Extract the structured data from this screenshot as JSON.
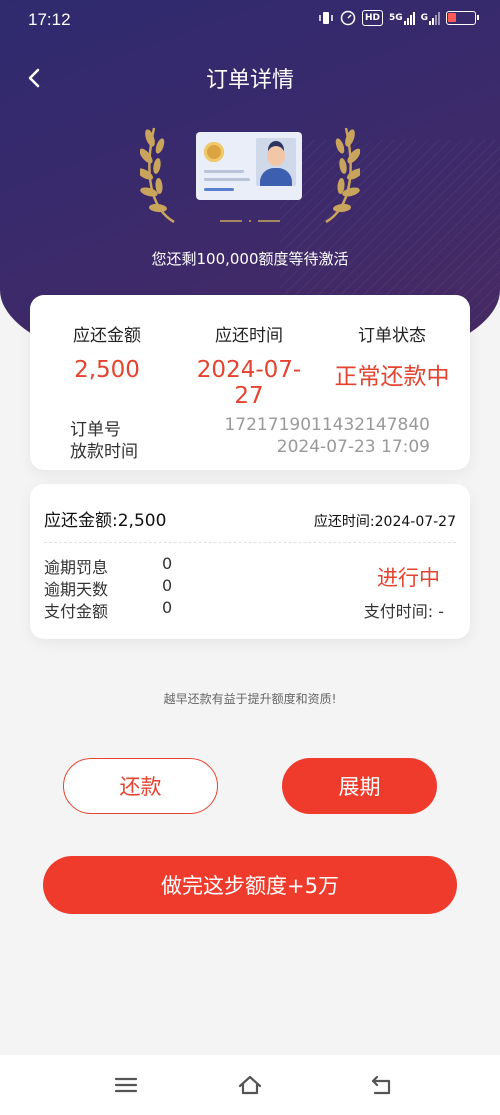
{
  "status_bar": {
    "time": "17:12",
    "hd": "HD",
    "network": "5G",
    "network2": "G"
  },
  "header": {
    "title": "订单详情",
    "subtitle": "您还剩100,000额度等待激活"
  },
  "summary": {
    "headers": [
      "应还金额",
      "应还时间",
      "订单状态"
    ],
    "values": [
      "2,500",
      "2024-07-27",
      "正常还款中"
    ],
    "order_no_label": "订单号",
    "order_no": "1721719011432147840",
    "loan_time_label": "放款时间",
    "loan_time": "2024-07-23 17:09"
  },
  "installment": {
    "amount_text": "应还金额:2,500",
    "due_text": "应还时间:2024-07-27",
    "rows": [
      {
        "label": "逾期罚息",
        "value": "0"
      },
      {
        "label": "逾期天数",
        "value": "0"
      },
      {
        "label": "支付金额",
        "value": "0"
      }
    ],
    "status": "进行中",
    "pay_time": "支付时间: -"
  },
  "tip": "越早还款有益于提升额度和资质!",
  "buttons": {
    "repay": "还款",
    "extend": "展期",
    "boost": "做完这步额度+5万"
  },
  "colors": {
    "accent": "#ee3b2c",
    "header_top": "#2f2a6e",
    "header_bottom": "#4a2a62"
  }
}
